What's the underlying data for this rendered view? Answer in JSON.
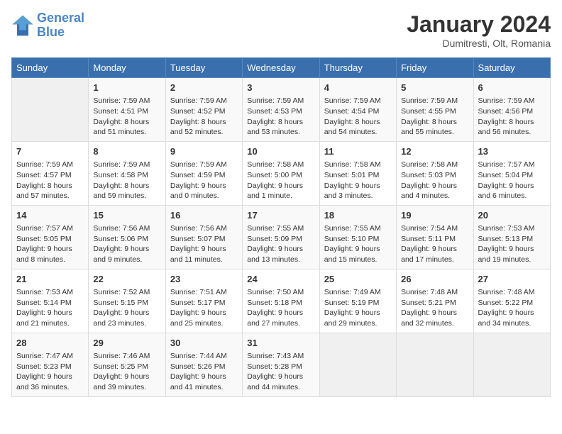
{
  "header": {
    "logo_line1": "General",
    "logo_line2": "Blue",
    "month": "January 2024",
    "location": "Dumitresti, Olt, Romania"
  },
  "weekdays": [
    "Sunday",
    "Monday",
    "Tuesday",
    "Wednesday",
    "Thursday",
    "Friday",
    "Saturday"
  ],
  "weeks": [
    [
      {
        "day": "",
        "info": ""
      },
      {
        "day": "1",
        "info": "Sunrise: 7:59 AM\nSunset: 4:51 PM\nDaylight: 8 hours\nand 51 minutes."
      },
      {
        "day": "2",
        "info": "Sunrise: 7:59 AM\nSunset: 4:52 PM\nDaylight: 8 hours\nand 52 minutes."
      },
      {
        "day": "3",
        "info": "Sunrise: 7:59 AM\nSunset: 4:53 PM\nDaylight: 8 hours\nand 53 minutes."
      },
      {
        "day": "4",
        "info": "Sunrise: 7:59 AM\nSunset: 4:54 PM\nDaylight: 8 hours\nand 54 minutes."
      },
      {
        "day": "5",
        "info": "Sunrise: 7:59 AM\nSunset: 4:55 PM\nDaylight: 8 hours\nand 55 minutes."
      },
      {
        "day": "6",
        "info": "Sunrise: 7:59 AM\nSunset: 4:56 PM\nDaylight: 8 hours\nand 56 minutes."
      }
    ],
    [
      {
        "day": "7",
        "info": "Sunrise: 7:59 AM\nSunset: 4:57 PM\nDaylight: 8 hours\nand 57 minutes."
      },
      {
        "day": "8",
        "info": "Sunrise: 7:59 AM\nSunset: 4:58 PM\nDaylight: 8 hours\nand 59 minutes."
      },
      {
        "day": "9",
        "info": "Sunrise: 7:59 AM\nSunset: 4:59 PM\nDaylight: 9 hours\nand 0 minutes."
      },
      {
        "day": "10",
        "info": "Sunrise: 7:58 AM\nSunset: 5:00 PM\nDaylight: 9 hours\nand 1 minute."
      },
      {
        "day": "11",
        "info": "Sunrise: 7:58 AM\nSunset: 5:01 PM\nDaylight: 9 hours\nand 3 minutes."
      },
      {
        "day": "12",
        "info": "Sunrise: 7:58 AM\nSunset: 5:03 PM\nDaylight: 9 hours\nand 4 minutes."
      },
      {
        "day": "13",
        "info": "Sunrise: 7:57 AM\nSunset: 5:04 PM\nDaylight: 9 hours\nand 6 minutes."
      }
    ],
    [
      {
        "day": "14",
        "info": "Sunrise: 7:57 AM\nSunset: 5:05 PM\nDaylight: 9 hours\nand 8 minutes."
      },
      {
        "day": "15",
        "info": "Sunrise: 7:56 AM\nSunset: 5:06 PM\nDaylight: 9 hours\nand 9 minutes."
      },
      {
        "day": "16",
        "info": "Sunrise: 7:56 AM\nSunset: 5:07 PM\nDaylight: 9 hours\nand 11 minutes."
      },
      {
        "day": "17",
        "info": "Sunrise: 7:55 AM\nSunset: 5:09 PM\nDaylight: 9 hours\nand 13 minutes."
      },
      {
        "day": "18",
        "info": "Sunrise: 7:55 AM\nSunset: 5:10 PM\nDaylight: 9 hours\nand 15 minutes."
      },
      {
        "day": "19",
        "info": "Sunrise: 7:54 AM\nSunset: 5:11 PM\nDaylight: 9 hours\nand 17 minutes."
      },
      {
        "day": "20",
        "info": "Sunrise: 7:53 AM\nSunset: 5:13 PM\nDaylight: 9 hours\nand 19 minutes."
      }
    ],
    [
      {
        "day": "21",
        "info": "Sunrise: 7:53 AM\nSunset: 5:14 PM\nDaylight: 9 hours\nand 21 minutes."
      },
      {
        "day": "22",
        "info": "Sunrise: 7:52 AM\nSunset: 5:15 PM\nDaylight: 9 hours\nand 23 minutes."
      },
      {
        "day": "23",
        "info": "Sunrise: 7:51 AM\nSunset: 5:17 PM\nDaylight: 9 hours\nand 25 minutes."
      },
      {
        "day": "24",
        "info": "Sunrise: 7:50 AM\nSunset: 5:18 PM\nDaylight: 9 hours\nand 27 minutes."
      },
      {
        "day": "25",
        "info": "Sunrise: 7:49 AM\nSunset: 5:19 PM\nDaylight: 9 hours\nand 29 minutes."
      },
      {
        "day": "26",
        "info": "Sunrise: 7:48 AM\nSunset: 5:21 PM\nDaylight: 9 hours\nand 32 minutes."
      },
      {
        "day": "27",
        "info": "Sunrise: 7:48 AM\nSunset: 5:22 PM\nDaylight: 9 hours\nand 34 minutes."
      }
    ],
    [
      {
        "day": "28",
        "info": "Sunrise: 7:47 AM\nSunset: 5:23 PM\nDaylight: 9 hours\nand 36 minutes."
      },
      {
        "day": "29",
        "info": "Sunrise: 7:46 AM\nSunset: 5:25 PM\nDaylight: 9 hours\nand 39 minutes."
      },
      {
        "day": "30",
        "info": "Sunrise: 7:44 AM\nSunset: 5:26 PM\nDaylight: 9 hours\nand 41 minutes."
      },
      {
        "day": "31",
        "info": "Sunrise: 7:43 AM\nSunset: 5:28 PM\nDaylight: 9 hours\nand 44 minutes."
      },
      {
        "day": "",
        "info": ""
      },
      {
        "day": "",
        "info": ""
      },
      {
        "day": "",
        "info": ""
      }
    ]
  ]
}
